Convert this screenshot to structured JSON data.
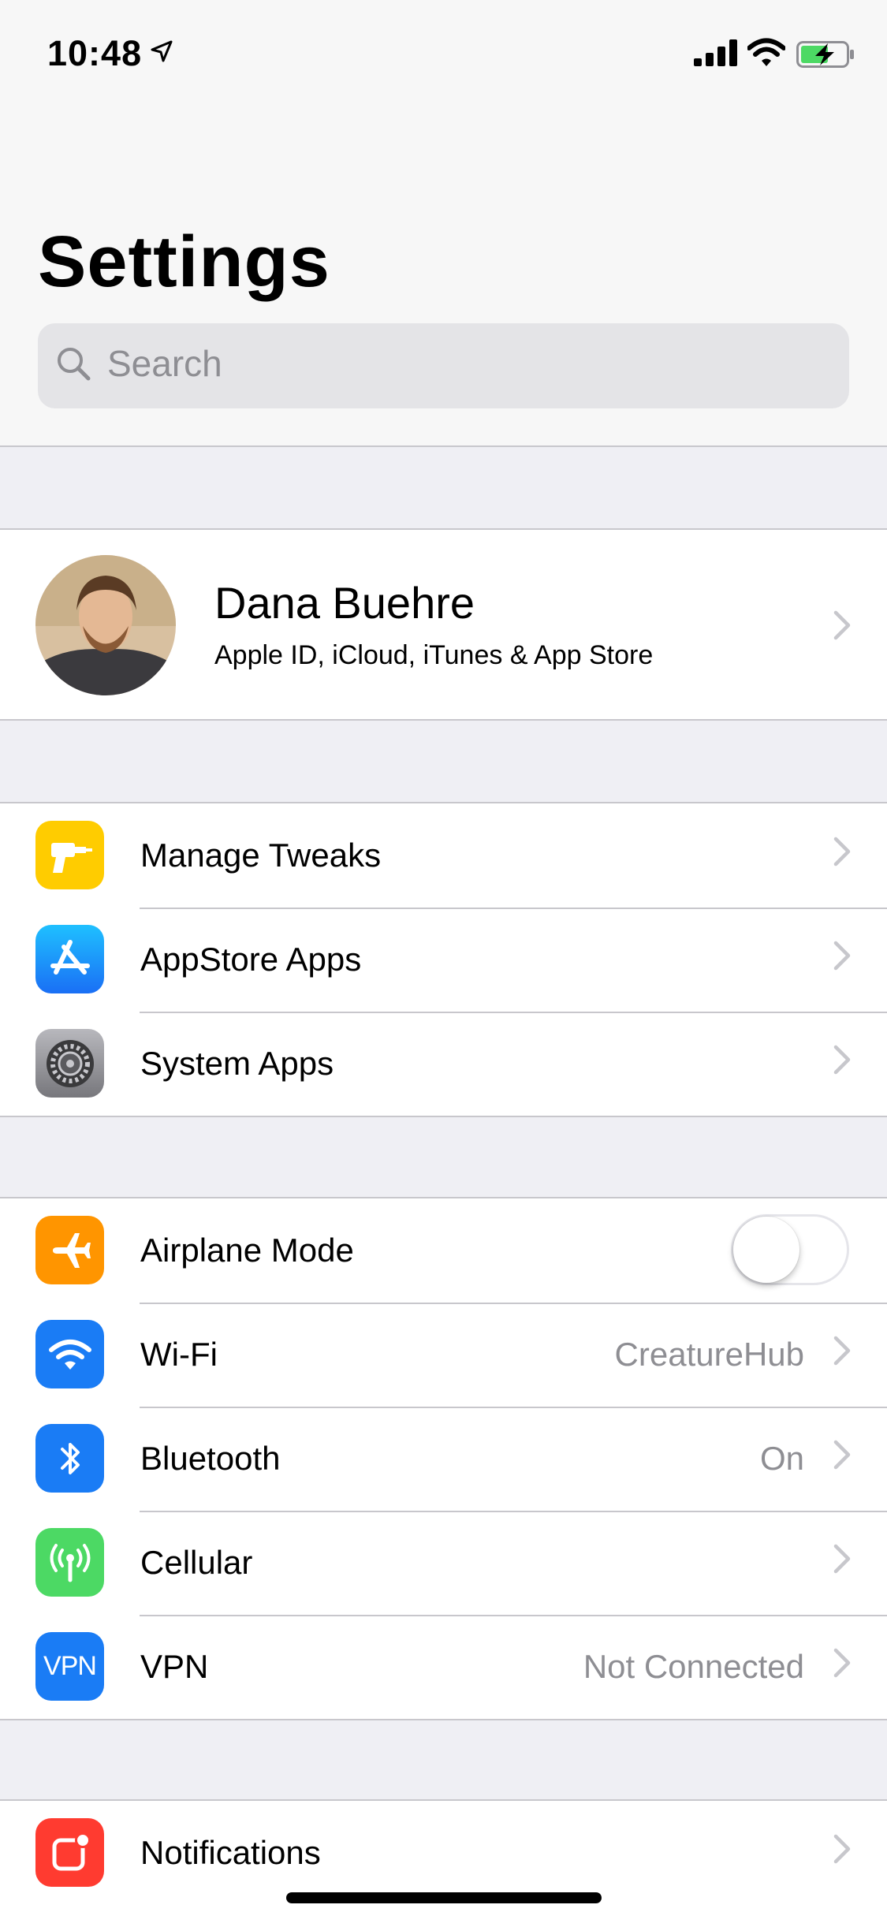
{
  "status_bar": {
    "time": "10:48",
    "icons": [
      "location-arrow-icon",
      "cellular-signal-icon",
      "wifi-icon",
      "battery-charging-icon"
    ]
  },
  "header": {
    "title": "Settings",
    "search_placeholder": "Search"
  },
  "profile": {
    "name": "Dana Buehre",
    "subtitle": "Apple ID, iCloud, iTunes & App Store"
  },
  "tweaks_group": [
    {
      "label": "Manage Tweaks",
      "icon": "drill-icon",
      "color": "#ffcc00"
    },
    {
      "label": "AppStore Apps",
      "icon": "app-store-icon",
      "color": "#1a8cff"
    },
    {
      "label": "System Apps",
      "icon": "gear-icon",
      "color": "#8e8e93"
    }
  ],
  "network_group": [
    {
      "label": "Airplane Mode",
      "icon": "airplane-icon",
      "color": "#ff9500",
      "toggle": false
    },
    {
      "label": "Wi-Fi",
      "icon": "wifi-icon",
      "color": "#1a7cf5",
      "value": "CreatureHub"
    },
    {
      "label": "Bluetooth",
      "icon": "bluetooth-icon",
      "color": "#1a7cf5",
      "value": "On"
    },
    {
      "label": "Cellular",
      "icon": "antenna-icon",
      "color": "#4cd964"
    },
    {
      "label": "VPN",
      "icon": "vpn-icon",
      "color": "#1a7cf5",
      "value": "Not Connected",
      "icon_text": "VPN"
    }
  ],
  "notify_group": [
    {
      "label": "Notifications",
      "icon": "notifications-icon",
      "color": "#ff3b30"
    }
  ]
}
